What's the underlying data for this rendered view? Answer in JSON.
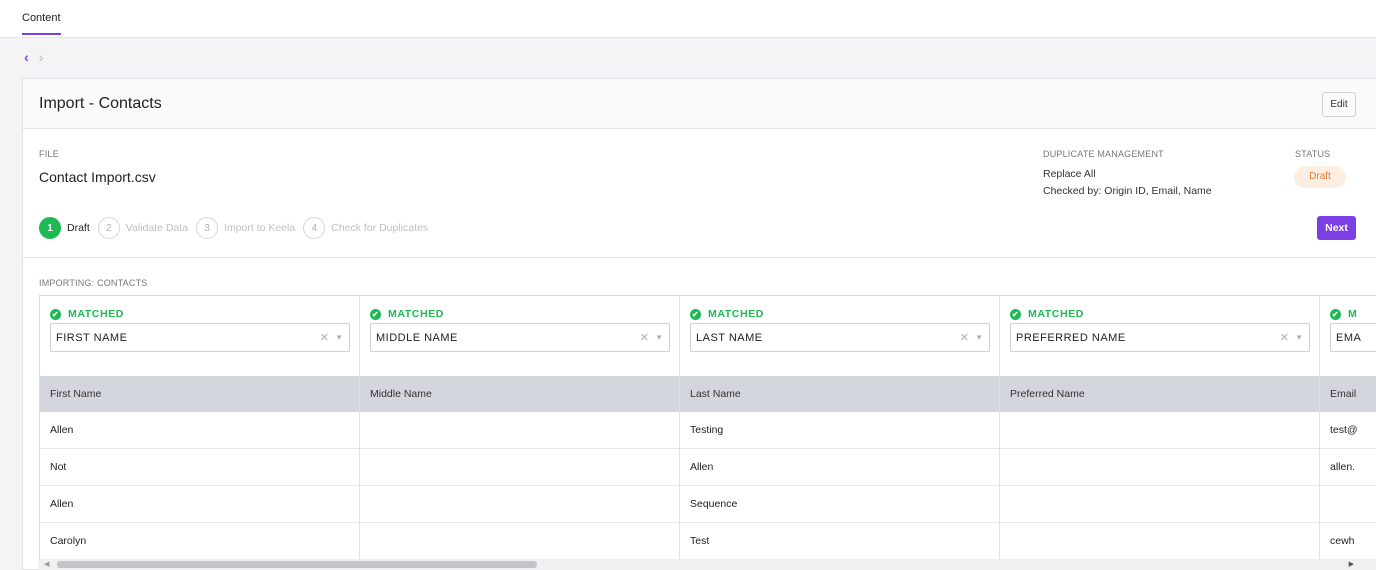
{
  "topbar": {
    "tab_label": "Content"
  },
  "nav": {
    "back": "‹",
    "forward": "›"
  },
  "header": {
    "title": "Import - Contacts",
    "edit_label": "Edit"
  },
  "file": {
    "label": "FILE",
    "name": "Contact Import.csv"
  },
  "duplicate": {
    "label": "DUPLICATE MANAGEMENT",
    "mode": "Replace All",
    "checked_by": "Checked by: Origin ID, Email, Name"
  },
  "status": {
    "label": "STATUS",
    "value": "Draft"
  },
  "steps": [
    {
      "num": "1",
      "label": "Draft"
    },
    {
      "num": "2",
      "label": "Validate Data"
    },
    {
      "num": "3",
      "label": "Import to Keela"
    },
    {
      "num": "4",
      "label": "Check for Duplicates"
    }
  ],
  "next_label": "Next",
  "importing_label": "IMPORTING: CONTACTS",
  "columns": [
    {
      "status": "MATCHED",
      "field": "FIRST NAME",
      "header": "First Name",
      "cells": [
        "Allen",
        "Not",
        "Allen",
        "Carolyn"
      ]
    },
    {
      "status": "MATCHED",
      "field": "MIDDLE NAME",
      "header": "Middle Name",
      "cells": [
        "",
        "",
        "",
        ""
      ]
    },
    {
      "status": "MATCHED",
      "field": "LAST NAME",
      "header": "Last Name",
      "cells": [
        "Testing",
        "Allen",
        "Sequence",
        "Test"
      ]
    },
    {
      "status": "MATCHED",
      "field": "PREFERRED NAME",
      "header": "Preferred Name",
      "cells": [
        "",
        "",
        "",
        ""
      ]
    },
    {
      "status": "M",
      "field": "EMA",
      "header": "Email",
      "cells": [
        "test@",
        "allen.",
        "",
        "cewh"
      ]
    }
  ],
  "icons": {
    "check": "✔",
    "clear": "✕",
    "caret": "▼",
    "scroll_left": "◀",
    "scroll_right": "▶"
  },
  "colors": {
    "accent": "#7b3fe4",
    "success": "#1db954",
    "draft_badge_bg": "#fdeee2",
    "draft_badge_text": "#e07b3a"
  }
}
